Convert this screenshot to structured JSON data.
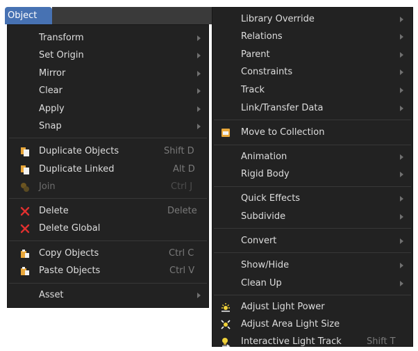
{
  "header": {
    "object_menu": "Object"
  },
  "left_menu": {
    "items": [
      {
        "label": "Transform"
      },
      {
        "label": "Set Origin"
      },
      {
        "label": "Mirror"
      },
      {
        "label": "Clear"
      },
      {
        "label": "Apply"
      },
      {
        "label": "Snap"
      },
      {
        "label": "Duplicate Objects",
        "shortcut": "Shift D",
        "icon": "duplicate-icon"
      },
      {
        "label": "Duplicate Linked",
        "shortcut": "Alt D",
        "icon": "duplicate-linked-icon"
      },
      {
        "label": "Join",
        "shortcut": "Ctrl J",
        "icon": "join-icon",
        "disabled": true
      },
      {
        "label": "Delete",
        "shortcut": "Delete",
        "icon": "delete-x-icon"
      },
      {
        "label": "Delete Global",
        "icon": "delete-x-icon"
      },
      {
        "label": "Copy Objects",
        "shortcut": "Ctrl C",
        "icon": "copy-clipboard-icon"
      },
      {
        "label": "Paste Objects",
        "shortcut": "Ctrl V",
        "icon": "paste-clipboard-icon"
      },
      {
        "label": "Asset"
      }
    ]
  },
  "right_menu": {
    "items": [
      {
        "label": "Library Override"
      },
      {
        "label": "Relations"
      },
      {
        "label": "Parent"
      },
      {
        "label": "Constraints"
      },
      {
        "label": "Track"
      },
      {
        "label": "Link/Transfer Data"
      },
      {
        "label": "Move to Collection",
        "icon": "collection-icon"
      },
      {
        "label": "Animation"
      },
      {
        "label": "Rigid Body"
      },
      {
        "label": "Quick Effects"
      },
      {
        "label": "Subdivide"
      },
      {
        "label": "Convert"
      },
      {
        "label": "Show/Hide"
      },
      {
        "label": "Clean Up"
      },
      {
        "label": "Adjust Light Power",
        "icon": "light-power-icon"
      },
      {
        "label": "Adjust Area Light Size",
        "icon": "area-light-size-icon"
      },
      {
        "label": "Interactive Light Track",
        "shortcut": "Shift T",
        "icon": "light-track-icon"
      }
    ]
  },
  "colors": {
    "accent": "#4772b3",
    "menu_bg": "#222222",
    "text": "#dedede",
    "shortcut": "#7a7a7a",
    "delete": "#e0302f",
    "clipboard": "#e8a73a"
  }
}
